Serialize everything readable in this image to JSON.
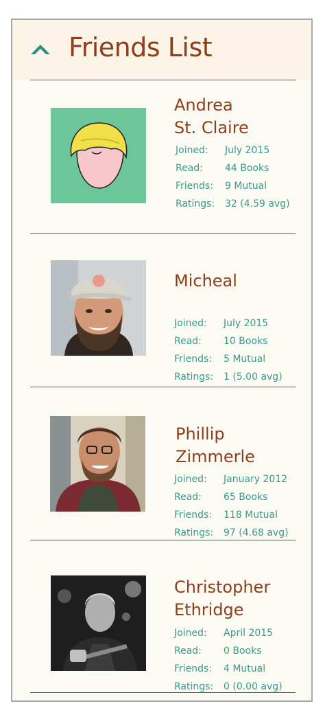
{
  "header": {
    "title": "Friends List",
    "collapse_icon": "chevron-up-icon"
  },
  "colors": {
    "accent_brown": "#8f3e1c",
    "accent_teal": "#3a9a8c",
    "header_bg": "#fcf4e6",
    "panel_bg": "#fbfbf4"
  },
  "friends": [
    {
      "name_line1": "Andrea",
      "name_line2": "St. Claire",
      "avatar": "cartoon-avatar",
      "labels": {
        "joined": "Joined:",
        "read": "Read:",
        "friends": "Friends:",
        "ratings": "Ratings:"
      },
      "joined": "July 2015",
      "read": "44 Books",
      "friends": "9 Mutual",
      "ratings": "32 (4.59 avg)"
    },
    {
      "name_line1": "Micheal",
      "name_line2": "",
      "avatar": "photo-avatar",
      "labels": {
        "joined": "Joined:",
        "read": "Read:",
        "friends": "Friends:",
        "ratings": "Ratings:"
      },
      "joined": "July 2015",
      "read": "10 Books",
      "friends": "5 Mutual",
      "ratings": "1 (5.00 avg)"
    },
    {
      "name_line1": "Phillip",
      "name_line2": "Zimmerle",
      "avatar": "photo-avatar",
      "labels": {
        "joined": "Joined:",
        "read": "Read:",
        "friends": "Friends:",
        "ratings": "Ratings:"
      },
      "joined": "January 2012",
      "read": "65 Books",
      "friends": "118 Mutual",
      "ratings": "97 (4.68 avg)"
    },
    {
      "name_line1": "Christopher",
      "name_line2": "Ethridge",
      "avatar": "photo-avatar",
      "labels": {
        "joined": "Joined:",
        "read": "Read:",
        "friends": "Friends:",
        "ratings": "Ratings:"
      },
      "joined": "April 2015",
      "read": "0 Books",
      "friends": "4 Mutual",
      "ratings": "0 (0.00 avg)"
    }
  ]
}
